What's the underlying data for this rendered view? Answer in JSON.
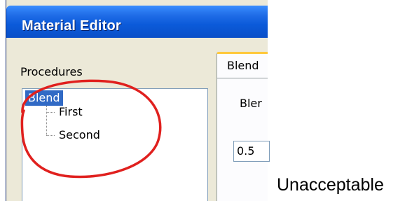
{
  "window": {
    "title": "Material Editor"
  },
  "procedures": {
    "label": "Procedures",
    "tree": [
      {
        "label": "Blend",
        "selected": true,
        "level": 0
      },
      {
        "label": "First",
        "selected": false,
        "level": 1
      },
      {
        "label": "Second",
        "selected": false,
        "level": 1
      }
    ]
  },
  "tab": {
    "label": "Blend",
    "field_label": "Bler",
    "value": "0.5"
  },
  "note": "Unacceptable",
  "colors": {
    "titlebar": "#0B5AD9",
    "selection": "#316AC5",
    "annotation_circle": "#E0201E",
    "tab_accent": "#FFC83C"
  }
}
